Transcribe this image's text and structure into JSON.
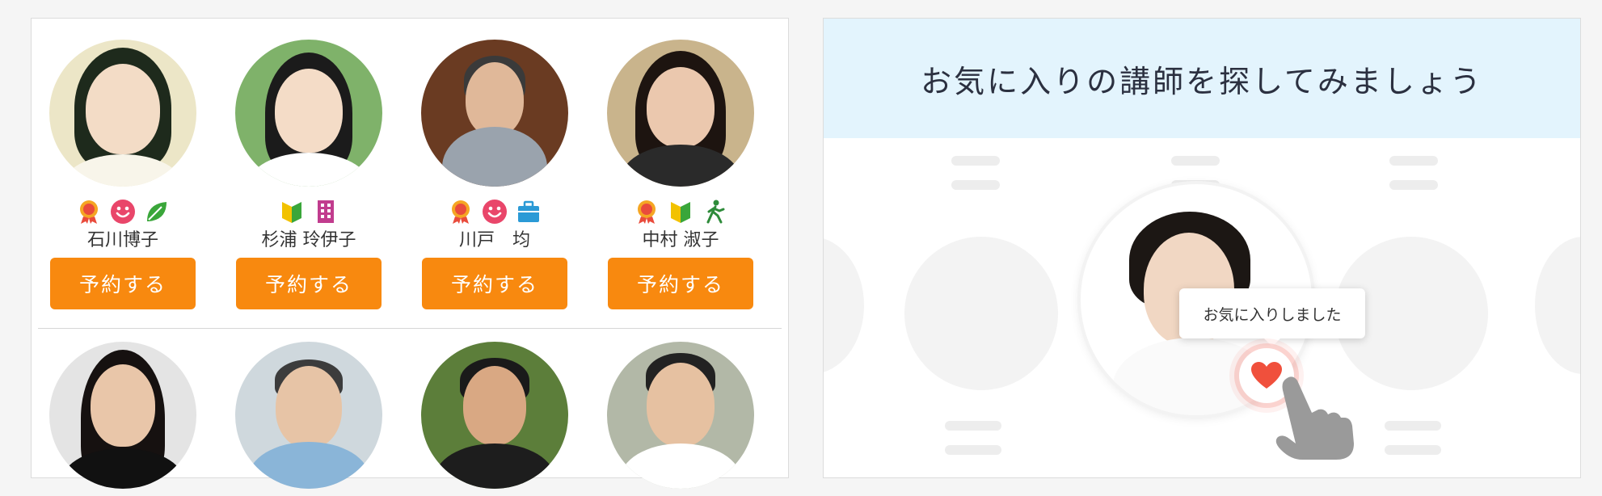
{
  "teachers_row1": [
    {
      "name": "石川博子",
      "button": "予約する",
      "badges": [
        "certified-ribbon-icon",
        "smile-icon",
        "leaf-icon"
      ]
    },
    {
      "name": "杉浦 玲伊子",
      "button": "予約する",
      "badges": [
        "beginner-mark-icon",
        "building-icon"
      ]
    },
    {
      "name": "川戸　均",
      "button": "予約する",
      "badges": [
        "certified-ribbon-icon",
        "smile-icon",
        "briefcase-icon"
      ]
    },
    {
      "name": "中村 淑子",
      "button": "予約する",
      "badges": [
        "certified-ribbon-icon",
        "beginner-mark-icon",
        "walking-person-icon"
      ]
    }
  ],
  "favorite_promo": {
    "banner": "お気に入りの講師を探してみましょう",
    "tooltip": "お気に入りしました"
  },
  "colors": {
    "accent_orange": "#f8890f",
    "banner_blue": "#e3f4fd",
    "heart_red": "#f0503c",
    "text_dark": "#2b3040"
  }
}
